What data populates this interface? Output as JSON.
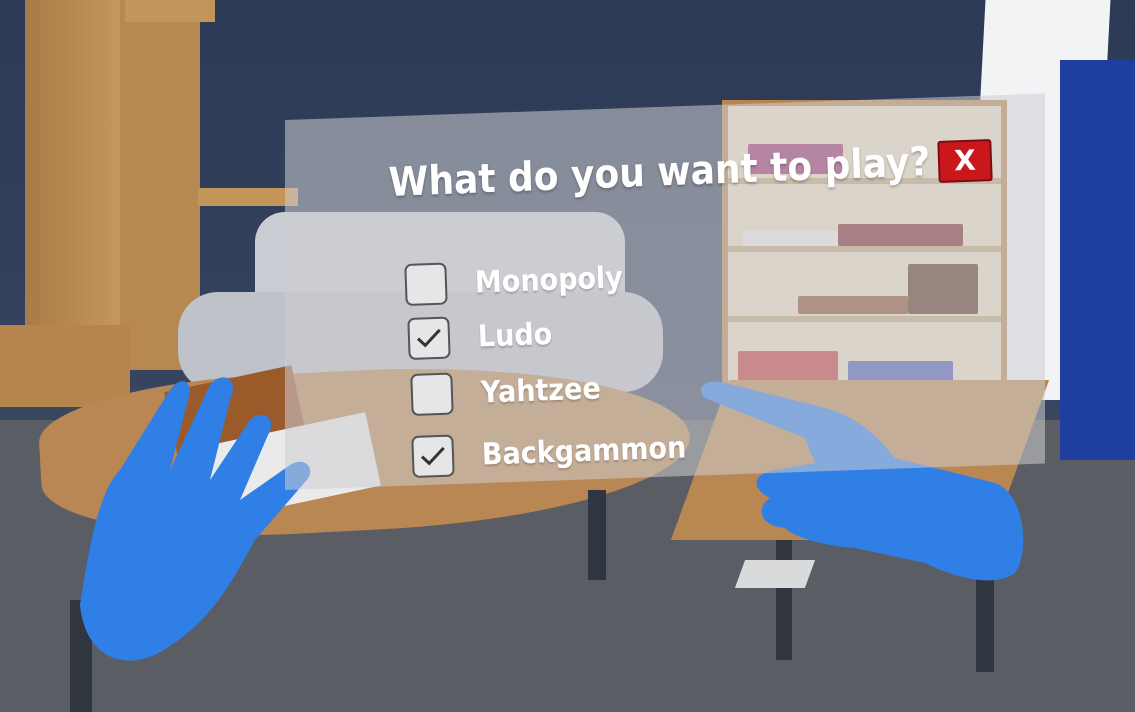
{
  "dialog": {
    "title": "What do you want to play?",
    "close_label": "X",
    "options": [
      {
        "label": "Monopoly",
        "checked": false
      },
      {
        "label": "Ludo",
        "checked": true
      },
      {
        "label": "Yahtzee",
        "checked": false
      },
      {
        "label": "Backgammon",
        "checked": true
      }
    ]
  },
  "icons": {
    "check": "check-icon",
    "close": "close-icon",
    "hands": "vr-hand-icon"
  },
  "colors": {
    "close_button": "#c9171c",
    "hands": "#2f7fe6",
    "panel": "#cdcdd2"
  }
}
